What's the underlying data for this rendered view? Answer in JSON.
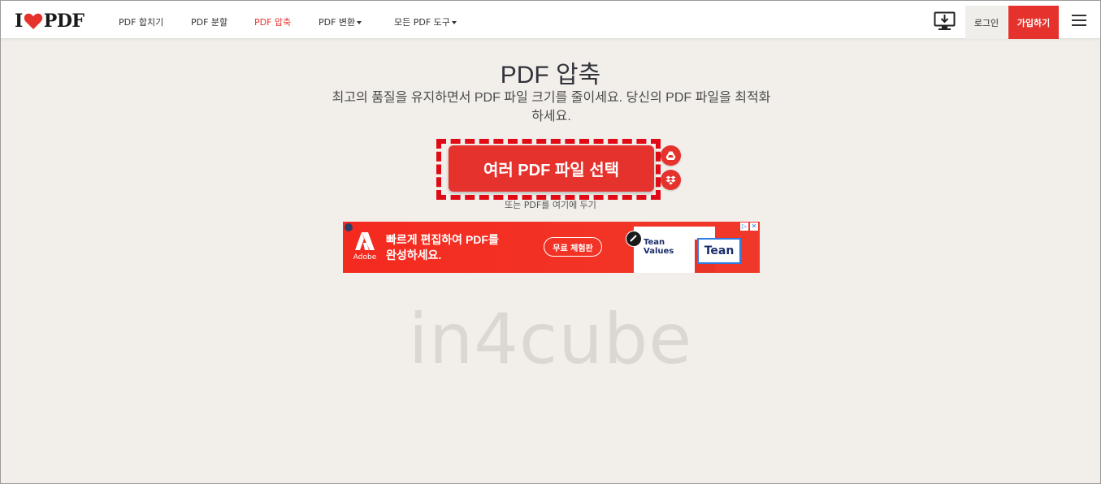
{
  "header": {
    "logo_left": "I",
    "logo_right": "PDF",
    "nav": [
      {
        "label": "PDF 합치기"
      },
      {
        "label": "PDF 분할"
      },
      {
        "label": "PDF 압축",
        "active": true
      },
      {
        "label": "PDF 변환"
      },
      {
        "label": "모든 PDF 도구"
      }
    ],
    "login_label": "로그인",
    "signup_label": "가입하기",
    "icons": [
      "desktop-download-icon",
      "hamburger-menu-icon"
    ]
  },
  "main": {
    "title": "PDF 압축",
    "subtitle_line1": "최고의 품질을 유지하면서 PDF 파일 크기를 줄이세요. 당신의 PDF 파일을 최적화",
    "subtitle_line2": "하세요.",
    "select_button": "여러 PDF 파일 선택",
    "cloud_icons": [
      "google-drive-icon",
      "dropbox-icon"
    ],
    "drop_hint": "또는 PDF를 여기에 두기"
  },
  "ad": {
    "brand": "Adobe",
    "headline_line1": "빠르게 편집하여 PDF를",
    "headline_line2": "완성하세요.",
    "cta": "무료 체험판",
    "card_text_line1": "Tean",
    "card_text_line2": "Values",
    "selected_text": "Tean",
    "badge_info": "▷",
    "badge_close": "✕"
  },
  "watermark": "in4cube",
  "colors": {
    "brand_red": "#e5322d",
    "highlight_red": "#e00b16",
    "page_bg": "#f2efeb"
  }
}
